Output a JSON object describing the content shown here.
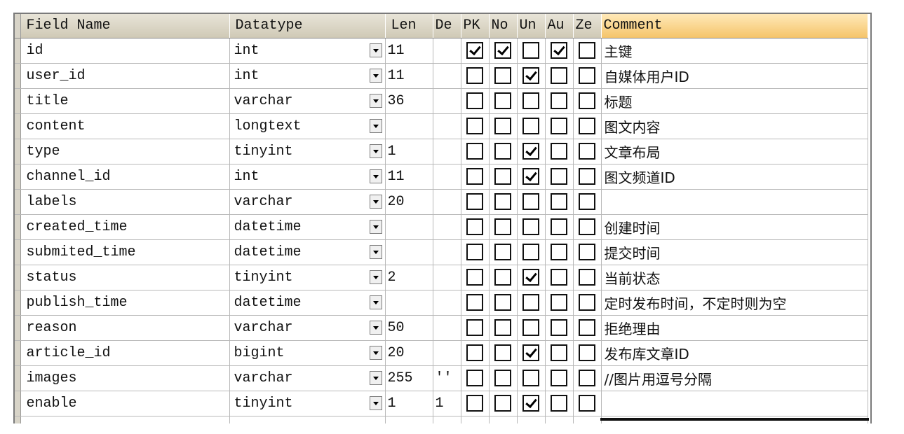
{
  "columns": {
    "field": "Field Name",
    "datatype": "Datatype",
    "len": "Len",
    "default": "De",
    "pk": "PK",
    "notnull": "No",
    "unsigned": "Un",
    "auto": "Au",
    "zero": "Ze",
    "comment": "Comment"
  },
  "rows": [
    {
      "field": "id",
      "type": "int",
      "len": "11",
      "def": "",
      "pk": true,
      "nn": true,
      "un": false,
      "au": true,
      "ze": false,
      "comment": "主键"
    },
    {
      "field": "user_id",
      "type": "int",
      "len": "11",
      "def": "",
      "pk": false,
      "nn": false,
      "un": true,
      "au": false,
      "ze": false,
      "comment": "自媒体用户ID"
    },
    {
      "field": "title",
      "type": "varchar",
      "len": "36",
      "def": "",
      "pk": false,
      "nn": false,
      "un": false,
      "au": false,
      "ze": false,
      "comment": "标题"
    },
    {
      "field": "content",
      "type": "longtext",
      "len": "",
      "def": "",
      "pk": false,
      "nn": false,
      "un": false,
      "au": false,
      "ze": false,
      "comment": "图文内容"
    },
    {
      "field": "type",
      "type": "tinyint",
      "len": "1",
      "def": "",
      "pk": false,
      "nn": false,
      "un": true,
      "au": false,
      "ze": false,
      "comment": "文章布局"
    },
    {
      "field": "channel_id",
      "type": "int",
      "len": "11",
      "def": "",
      "pk": false,
      "nn": false,
      "un": true,
      "au": false,
      "ze": false,
      "comment": "图文频道ID"
    },
    {
      "field": "labels",
      "type": "varchar",
      "len": "20",
      "def": "",
      "pk": false,
      "nn": false,
      "un": false,
      "au": false,
      "ze": false,
      "comment": ""
    },
    {
      "field": "created_time",
      "type": "datetime",
      "len": "",
      "def": "",
      "pk": false,
      "nn": false,
      "un": false,
      "au": false,
      "ze": false,
      "comment": "创建时间"
    },
    {
      "field": "submited_time",
      "type": "datetime",
      "len": "",
      "def": "",
      "pk": false,
      "nn": false,
      "un": false,
      "au": false,
      "ze": false,
      "comment": "提交时间"
    },
    {
      "field": "status",
      "type": "tinyint",
      "len": "2",
      "def": "",
      "pk": false,
      "nn": false,
      "un": true,
      "au": false,
      "ze": false,
      "comment": "当前状态"
    },
    {
      "field": "publish_time",
      "type": "datetime",
      "len": "",
      "def": "",
      "pk": false,
      "nn": false,
      "un": false,
      "au": false,
      "ze": false,
      "comment": "定时发布时间，不定时则为空"
    },
    {
      "field": "reason",
      "type": "varchar",
      "len": "50",
      "def": "",
      "pk": false,
      "nn": false,
      "un": false,
      "au": false,
      "ze": false,
      "comment": "拒绝理由"
    },
    {
      "field": "article_id",
      "type": "bigint",
      "len": "20",
      "def": "",
      "pk": false,
      "nn": false,
      "un": true,
      "au": false,
      "ze": false,
      "comment": "发布库文章ID"
    },
    {
      "field": "images",
      "type": "varchar",
      "len": "255",
      "def": "''",
      "pk": false,
      "nn": false,
      "un": false,
      "au": false,
      "ze": false,
      "comment": "//图片用逗号分隔"
    },
    {
      "field": "enable",
      "type": "tinyint",
      "len": "1",
      "def": "1",
      "pk": false,
      "nn": false,
      "un": true,
      "au": false,
      "ze": false,
      "comment": ""
    }
  ]
}
